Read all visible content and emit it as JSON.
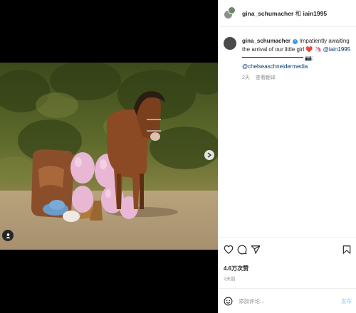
{
  "header": {
    "username": "gina_schumacher",
    "conjunction": " 和 ",
    "coauthor": "iain1995"
  },
  "caption": {
    "username": "gina_schumacher",
    "text": "Impatiently awaiting the arrival of our little girl",
    "heart": "❤️",
    "extra_emoji": "🦄",
    "mention": "@iain1995",
    "camera_emoji": "📷",
    "colon": ":",
    "credit": "@chelseaschneidermedia",
    "time": "2天",
    "translate": "查看翻译"
  },
  "actions": {
    "like_icon": "heart-outline-icon",
    "comment_icon": "comment-bubble-icon",
    "share_icon": "paper-plane-icon",
    "save_icon": "bookmark-icon"
  },
  "stats": {
    "likes": "4.6万次赞",
    "posted": "2天前"
  },
  "comment": {
    "emoji_icon": "smiley-icon",
    "placeholder": "添加评论...",
    "post_label": "发布"
  },
  "colors": {
    "accent_blue": "#3897f0",
    "link": "#00376b",
    "post_disabled": "#b2dffc",
    "heart": "#e0245e"
  }
}
